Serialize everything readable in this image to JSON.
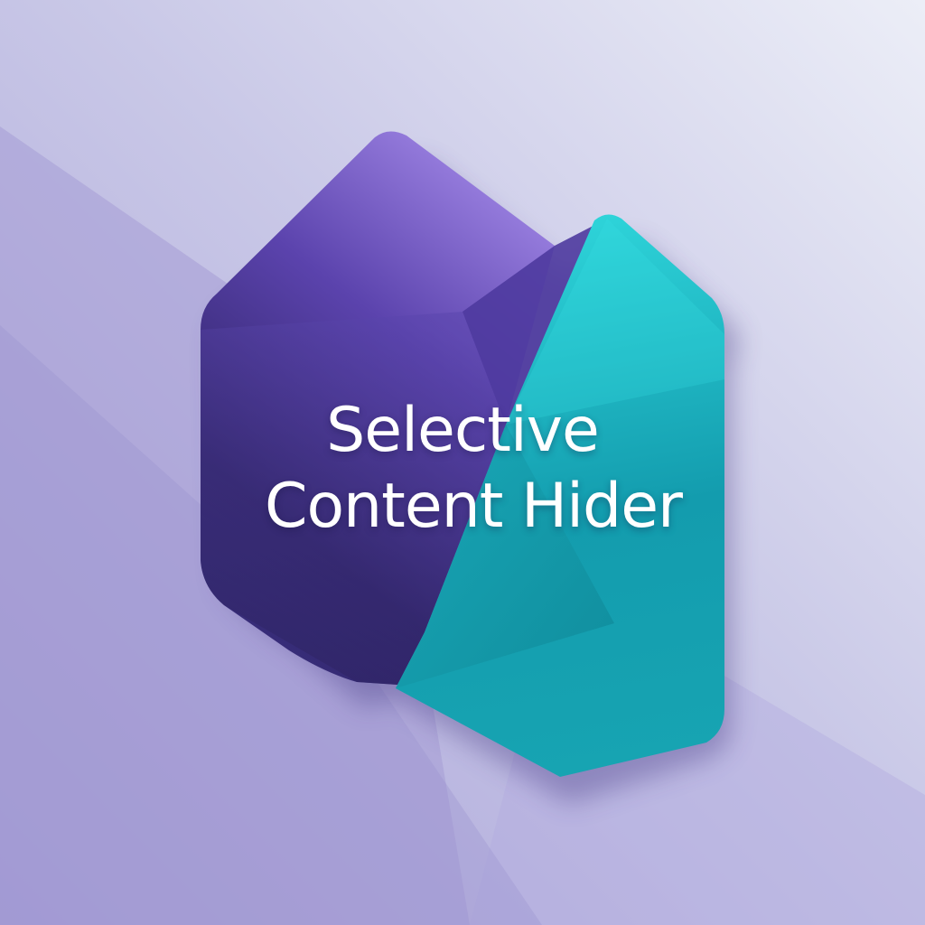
{
  "logo": {
    "title_line_1": "Selective",
    "title_line_2": "Content Hider"
  },
  "colors": {
    "background_light": "#e6e8f4",
    "background_mid": "#c7c6e6",
    "background_dark": "#a79fd6",
    "purple_light": "#9a7ee0",
    "purple_dark": "#2d2563",
    "teal_light": "#2cd3d8",
    "teal_dark": "#0e8c9b",
    "text": "#ffffff"
  }
}
